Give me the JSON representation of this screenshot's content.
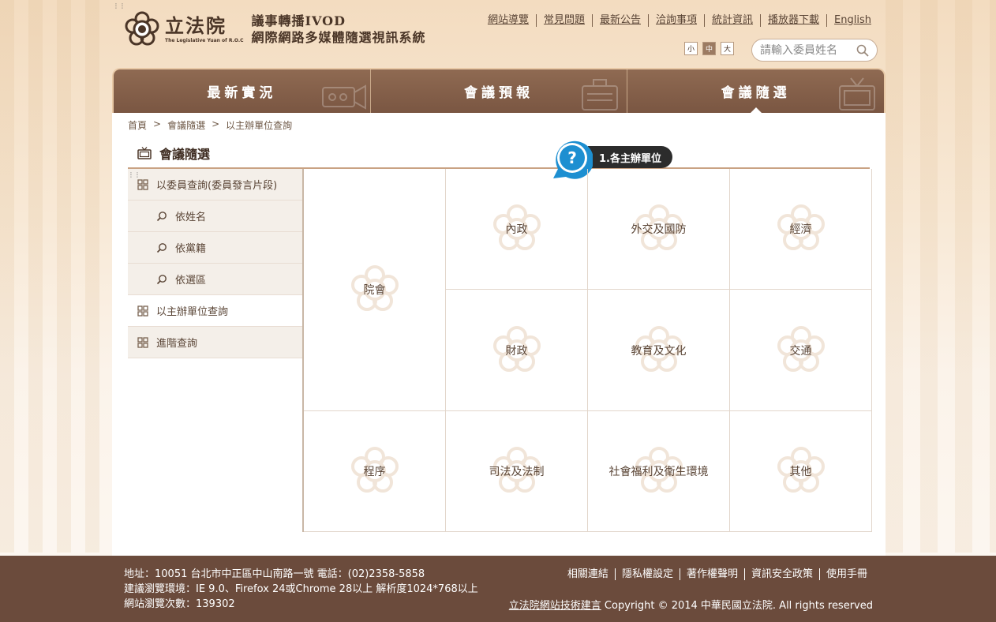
{
  "header": {
    "logo_cn": "立法院",
    "logo_en": "The Legislative Yuan of R.O.C",
    "system_title_line1": "議事轉播IVOD",
    "system_title_line2": "網際網路多媒體隨選視訊系統",
    "top_links": [
      "網站導覽",
      "常見問題",
      "最新公告",
      "洽詢事項",
      "統計資訊",
      "播放器下載",
      "English"
    ],
    "font_sizes": [
      "小",
      "中",
      "大"
    ],
    "search_placeholder": "請輸入委員姓名"
  },
  "nav": {
    "tabs": [
      "最新實況",
      "會議預報",
      "會議隨選"
    ],
    "active_tab": "會議隨選"
  },
  "breadcrumb": [
    "首頁",
    "會議隨選",
    "以主辦單位查詢"
  ],
  "section": {
    "title": "會議隨選",
    "help_label": "1.各主辦單位"
  },
  "sidebar": {
    "items": [
      {
        "label": "以委員查詢(委員發言片段)",
        "type": "group"
      },
      {
        "label": "依姓名",
        "type": "sub"
      },
      {
        "label": "依黨籍",
        "type": "sub"
      },
      {
        "label": "依選區",
        "type": "sub"
      },
      {
        "label": "以主辦單位查詢",
        "type": "group",
        "active": true
      },
      {
        "label": "進階查詢",
        "type": "group"
      }
    ]
  },
  "grid": {
    "cells": [
      "院會",
      "內政",
      "外交及國防",
      "經濟",
      "財政",
      "教育及文化",
      "交通",
      "程序",
      "司法及法制",
      "社會福利及衛生環境",
      "其他"
    ]
  },
  "footer": {
    "address": "地址：10051 台北市中正區中山南路一號 電話：(02)2358-5858",
    "browser": "建議瀏覽環境：IE 9.0、Firefox 24或Chrome 28以上 解析度1024*768以上",
    "visits": "網站瀏覽次數：139302",
    "links": [
      "相關連結",
      "隱私權設定",
      "著作權聲明",
      "資訊安全政策",
      "使用手冊"
    ],
    "copyright_link": "立法院網站技術建言",
    "copyright_text": " Copyright © 2014 中華民國立法院. All rights reserved"
  },
  "colors": {
    "nav_brown": "#7a5642",
    "footer_brown": "#6b4b3c",
    "accent_tan": "#c9a283",
    "help_blue": "#1d8fd1"
  }
}
